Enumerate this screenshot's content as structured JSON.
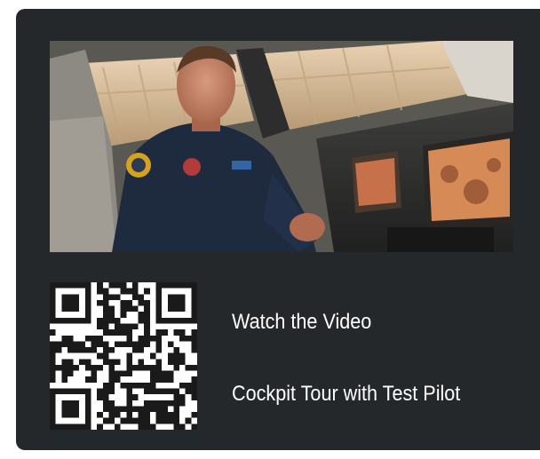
{
  "card": {
    "title": "Watch the Video",
    "subtitle": "Cockpit Tour with Test Pilot"
  },
  "colors": {
    "card_background": "#25282b",
    "text": "#ffffff"
  }
}
